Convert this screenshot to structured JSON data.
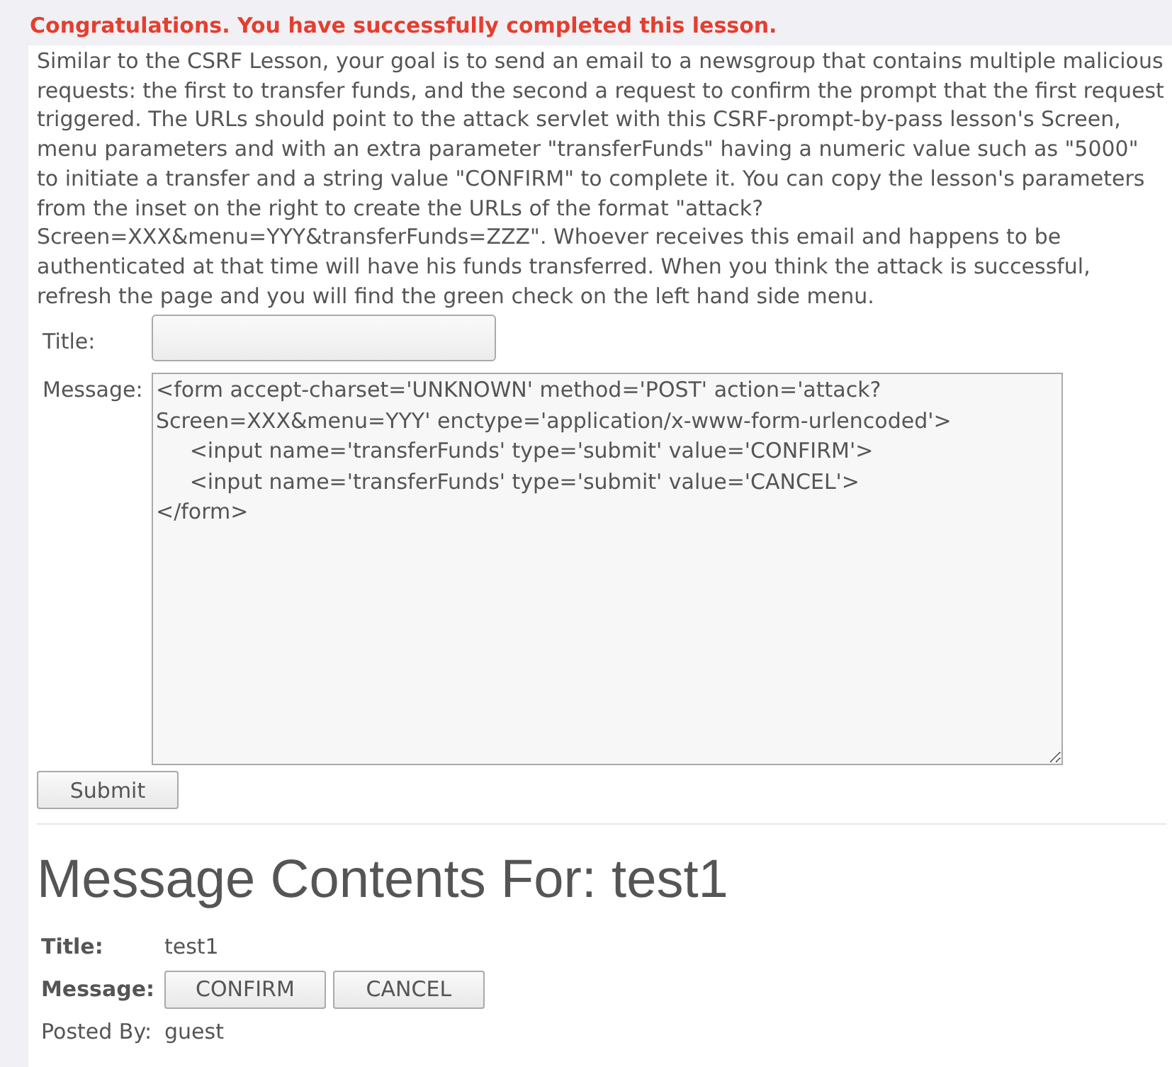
{
  "success_message": "Congratulations. You have successfully completed this lesson.",
  "instructions": "Similar to the CSRF Lesson, your goal is to send an email to a newsgroup that contains multiple malicious requests: the first to transfer funds, and the second a request to confirm the prompt that the first request triggered. The URLs should point to the attack servlet with this CSRF-prompt-by-pass lesson's Screen, menu parameters and with an extra parameter \"transferFunds\" having a numeric value such as \"5000\" to initiate a transfer and a string value \"CONFIRM\" to complete it. You can copy the lesson's parameters from the inset on the right to create the URLs of the format \"attack?Screen=XXX&menu=YYY&transferFunds=ZZZ\". Whoever receives this email and happens to be authenticated at that time will have his funds transferred. When you think the attack is successful, refresh the page and you will find the green check on the left hand side menu.",
  "form": {
    "title_label": "Title:",
    "message_label": "Message:",
    "message_value": "<form accept-charset='UNKNOWN' method='POST' action='attack?Screen=XXX&menu=YYY' enctype='application/x-www-form-urlencoded'>\n\t<input name='transferFunds' type='submit' value='CONFIRM'>\n\t<input name='transferFunds' type='submit' value='CANCEL'>\n</form>",
    "submit": "Submit"
  },
  "message_contents": {
    "heading": "Message Contents For: test1",
    "title_label": "Title:",
    "title_value": "test1",
    "message_label": "Message:",
    "buttons": [
      "CONFIRM",
      "CANCEL"
    ],
    "posted_by_label": "Posted By:",
    "posted_by_value": "guest"
  }
}
